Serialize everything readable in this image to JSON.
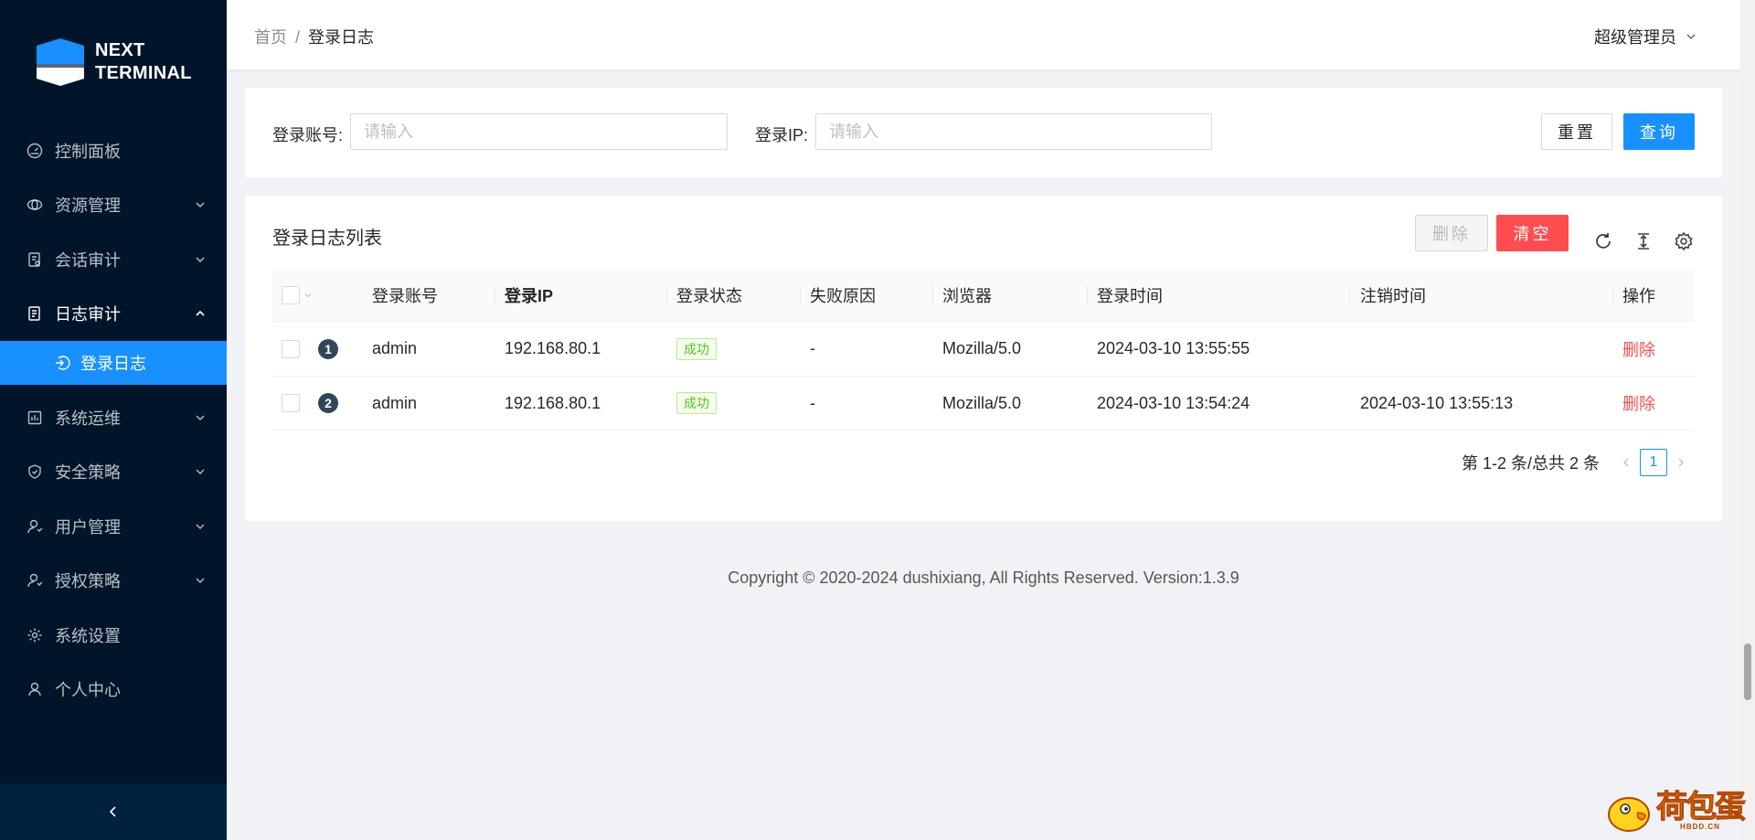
{
  "brand": {
    "line1": "NEXT",
    "line2": "TERMINAL",
    "accent": "#1890ff",
    "sidebar_bg": "#001529"
  },
  "sidebar": {
    "items": [
      {
        "label": "控制面板",
        "icon": "dashboard-icon"
      },
      {
        "label": "资源管理",
        "icon": "cloud-icon"
      },
      {
        "label": "会话审计",
        "icon": "audit-icon"
      },
      {
        "label": "日志审计",
        "icon": "log-icon"
      },
      {
        "label": "系统运维",
        "icon": "ops-icon"
      },
      {
        "label": "安全策略",
        "icon": "shield-icon"
      },
      {
        "label": "用户管理",
        "icon": "user-icon"
      },
      {
        "label": "授权策略",
        "icon": "user-icon"
      },
      {
        "label": "系统设置",
        "icon": "gear-icon"
      },
      {
        "label": "个人中心",
        "icon": "user-icon"
      }
    ],
    "sub_active": {
      "label": "登录日志",
      "icon": "login-icon"
    }
  },
  "header": {
    "breadcrumb_home": "首页",
    "breadcrumb_sep": "/",
    "breadcrumb_current": "登录日志",
    "user_name": "超级管理员"
  },
  "search": {
    "account_label": "登录账号:",
    "account_placeholder": "请输入",
    "account_value": "",
    "ip_label": "登录IP:",
    "ip_placeholder": "请输入",
    "ip_value": "",
    "reset_label": "重置",
    "query_label": "查询"
  },
  "table": {
    "title": "登录日志列表",
    "delete_label": "删除",
    "clear_label": "清空",
    "columns": [
      "登录账号",
      "登录IP",
      "登录状态",
      "失败原因",
      "浏览器",
      "登录时间",
      "注销时间",
      "操作"
    ],
    "rows": [
      {
        "index": "1",
        "account": "admin",
        "ip": "192.168.80.1",
        "status": "成功",
        "reason": "-",
        "browser": "Mozilla/5.0",
        "login_time": "2024-03-10 13:55:55",
        "logout_time": "",
        "action": "删除"
      },
      {
        "index": "2",
        "account": "admin",
        "ip": "192.168.80.1",
        "status": "成功",
        "reason": "-",
        "browser": "Mozilla/5.0",
        "login_time": "2024-03-10 13:54:24",
        "logout_time": "2024-03-10 13:55:13",
        "action": "删除"
      }
    ]
  },
  "pagination": {
    "summary": "第 1-2 条/总共 2 条",
    "current_page": "1"
  },
  "footer": {
    "text": "Copyright © 2020-2024 dushixiang, All Rights Reserved. Version:1.3.9"
  },
  "watermark": {
    "text": "荷包蛋",
    "sub": "HBDD.CN"
  }
}
